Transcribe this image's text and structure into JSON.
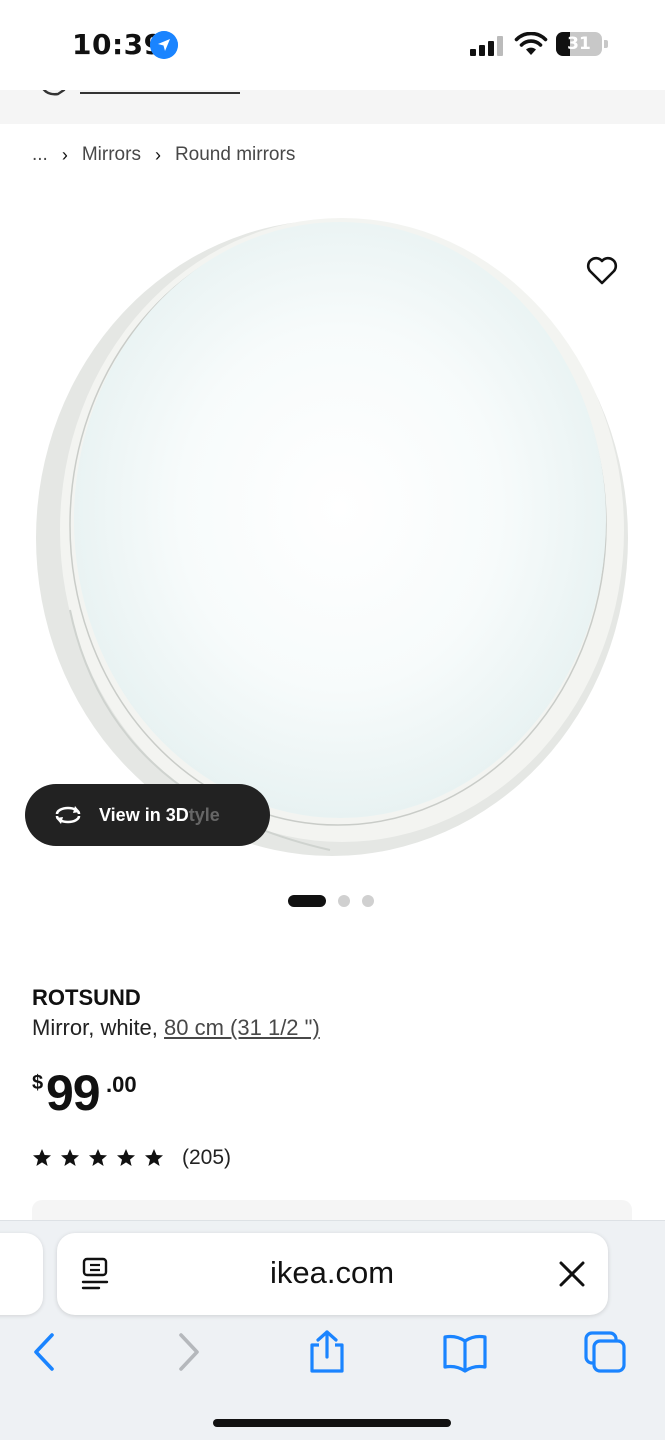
{
  "status_bar": {
    "time": "10:39",
    "battery_level": "31",
    "battery_fraction": 0.31,
    "icons": [
      "location-arrow-icon",
      "signal-bars-icon",
      "wifi-icon",
      "battery-icon"
    ]
  },
  "breadcrumb": {
    "items": [
      "...",
      "Mirrors",
      "Round mirrors"
    ]
  },
  "image": {
    "view3d_label": "View in 3D",
    "view3d_ghost": "tyle",
    "carousel_count": 3,
    "carousel_active": 1
  },
  "product": {
    "name": "ROTSUND",
    "description": "Mirror, white, ",
    "size": "80 cm (31 1/2 \")",
    "price_currency": "$",
    "price_integer": "99",
    "price_decimal": ".00",
    "rating_stars": 5,
    "review_count": "(205)"
  },
  "browser": {
    "url": "ikea.com",
    "toolbar_icons": [
      "back-icon",
      "forward-icon",
      "share-icon",
      "bookmarks-icon",
      "tabs-icon"
    ]
  },
  "colors": {
    "accent_blue": "#1a84ff",
    "text_dark": "#111111",
    "button_dark": "#222222"
  }
}
